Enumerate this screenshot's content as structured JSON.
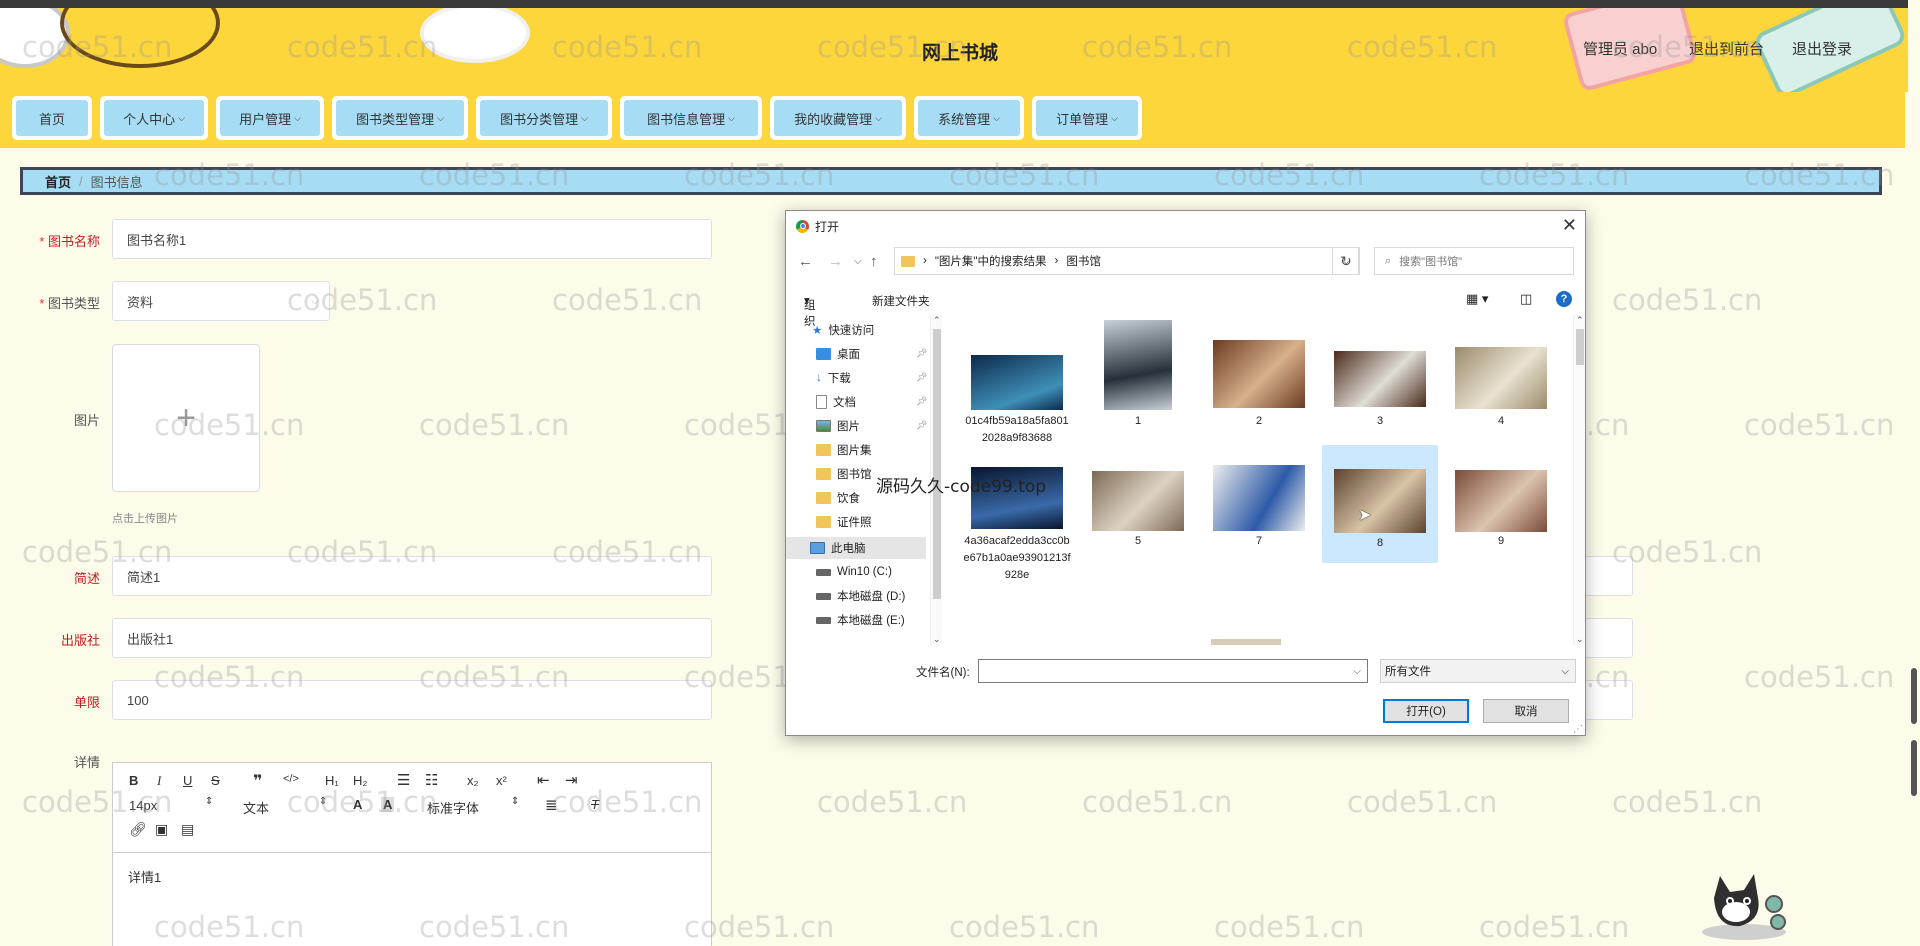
{
  "header": {
    "title": "网上书城",
    "admin_label": "管理员 abo",
    "back_label": "退出到前台",
    "logout_label": "退出登录"
  },
  "nav": [
    {
      "label": "首页",
      "has_arrow": false
    },
    {
      "label": "个人中心",
      "has_arrow": true
    },
    {
      "label": "用户管理",
      "has_arrow": true
    },
    {
      "label": "图书类型管理",
      "has_arrow": true
    },
    {
      "label": "图书分类管理",
      "has_arrow": true
    },
    {
      "label": "图书信息管理",
      "has_arrow": true
    },
    {
      "label": "我的收藏管理",
      "has_arrow": true
    },
    {
      "label": "系统管理",
      "has_arrow": true
    },
    {
      "label": "订单管理",
      "has_arrow": true
    }
  ],
  "breadcrumb": {
    "home": "首页",
    "current": "图书信息"
  },
  "form": {
    "name_label": "图书名称",
    "name_value": "图书名称1",
    "type_label": "图书类型",
    "type_value": "资料",
    "image_label": "图片",
    "upload_hint": "点击上传图片",
    "intro_label": "简述",
    "intro_value": "简述1",
    "publisher_label": "出版社",
    "publisher_value": "出版社1",
    "limit_label": "单限",
    "limit_value": "100",
    "detail_label": "详情",
    "detail_value": "详情1"
  },
  "editor": {
    "font_size": "14px",
    "text_style": "文本",
    "font_family": "标准字体"
  },
  "watermark": "code51.cn",
  "overlay_text": "源码久久-code99.top",
  "dialog": {
    "title": "打开",
    "path_root": "\"图片集\"中的搜索结果",
    "path_leaf": "图书馆",
    "search_placeholder": "搜索\"图书馆\"",
    "organize": "组织",
    "new_folder": "新建文件夹",
    "nav_items": [
      {
        "label": "快速访问",
        "icon": "star-icon"
      },
      {
        "label": "桌面",
        "icon": "desktop-icon",
        "pinned": true
      },
      {
        "label": "下载",
        "icon": "download-icon",
        "pinned": true
      },
      {
        "label": "文档",
        "icon": "document-icon",
        "pinned": true
      },
      {
        "label": "图片",
        "icon": "picture-icon",
        "pinned": true
      },
      {
        "label": "图片集",
        "icon": "folder-icon"
      },
      {
        "label": "图书馆",
        "icon": "folder-icon"
      },
      {
        "label": "饮食",
        "icon": "folder-icon"
      },
      {
        "label": "证件照",
        "icon": "folder-icon"
      },
      {
        "label": "此电脑",
        "icon": "computer-icon"
      },
      {
        "label": "Win10 (C:)",
        "icon": "drive-icon"
      },
      {
        "label": "本地磁盘 (D:)",
        "icon": "drive-icon"
      },
      {
        "label": "本地磁盘 (E:)",
        "icon": "drive-icon"
      }
    ],
    "files": [
      {
        "name": "01c4fb59a18a5fa8012028a9f83688",
        "colors": [
          "#0c2a4a",
          "#3f8fb8"
        ]
      },
      {
        "name": "1",
        "colors": [
          "#25303a",
          "#c8d0d8"
        ]
      },
      {
        "name": "2",
        "colors": [
          "#6b3a22",
          "#d8b08a"
        ]
      },
      {
        "name": "3",
        "colors": [
          "#4a2a1c",
          "#e0ddd5"
        ]
      },
      {
        "name": "4",
        "colors": [
          "#9a8a6a",
          "#e9e2d1"
        ]
      },
      {
        "name": "4a36acaf2edda3cc0be67b1a0ae93901213f928e",
        "colors": [
          "#08152e",
          "#3a6aa8"
        ]
      },
      {
        "name": "5",
        "colors": [
          "#7d6a55",
          "#ddd3c4"
        ]
      },
      {
        "name": "7",
        "colors": [
          "#2d5aa8",
          "#eeeeee"
        ]
      },
      {
        "name": "8",
        "colors": [
          "#5a4230",
          "#d9c3a5"
        ]
      },
      {
        "name": "9",
        "colors": [
          "#7a4a38",
          "#dcc5b0"
        ]
      }
    ],
    "filename_label": "文件名(N):",
    "filter_label": "所有文件",
    "open_button": "打开(O)",
    "cancel_button": "取消"
  },
  "colors": {
    "header_bg": "#fdd63c",
    "nav_item_bg": "#a6ddf5",
    "page_bg": "#fdfbea",
    "required_label": "#c02020",
    "dialog_accent": "#0078d7"
  }
}
